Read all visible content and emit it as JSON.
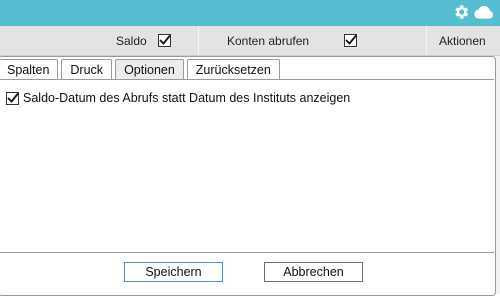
{
  "columns": {
    "saldo_label": "Saldo",
    "saldo_checked": true,
    "konten_label": "Konten abrufen",
    "konten_checked": true,
    "aktionen_label": "Aktionen"
  },
  "icons": {
    "settings": "gear-icon",
    "cloud": "cloud-icon"
  },
  "tabs": [
    {
      "label": "Spalten",
      "active": false
    },
    {
      "label": "Druck",
      "active": false
    },
    {
      "label": "Optionen",
      "active": true
    },
    {
      "label": "Zurücksetzen",
      "active": false
    }
  ],
  "options": {
    "saldo_datum_label": "Saldo-Datum des Abrufs statt Datum des Instituts anzeigen",
    "saldo_datum_checked": true
  },
  "buttons": {
    "save": "Speichern",
    "cancel": "Abbrechen"
  },
  "colors": {
    "header": "#56bccf",
    "primary_border": "#4a8fd6"
  }
}
